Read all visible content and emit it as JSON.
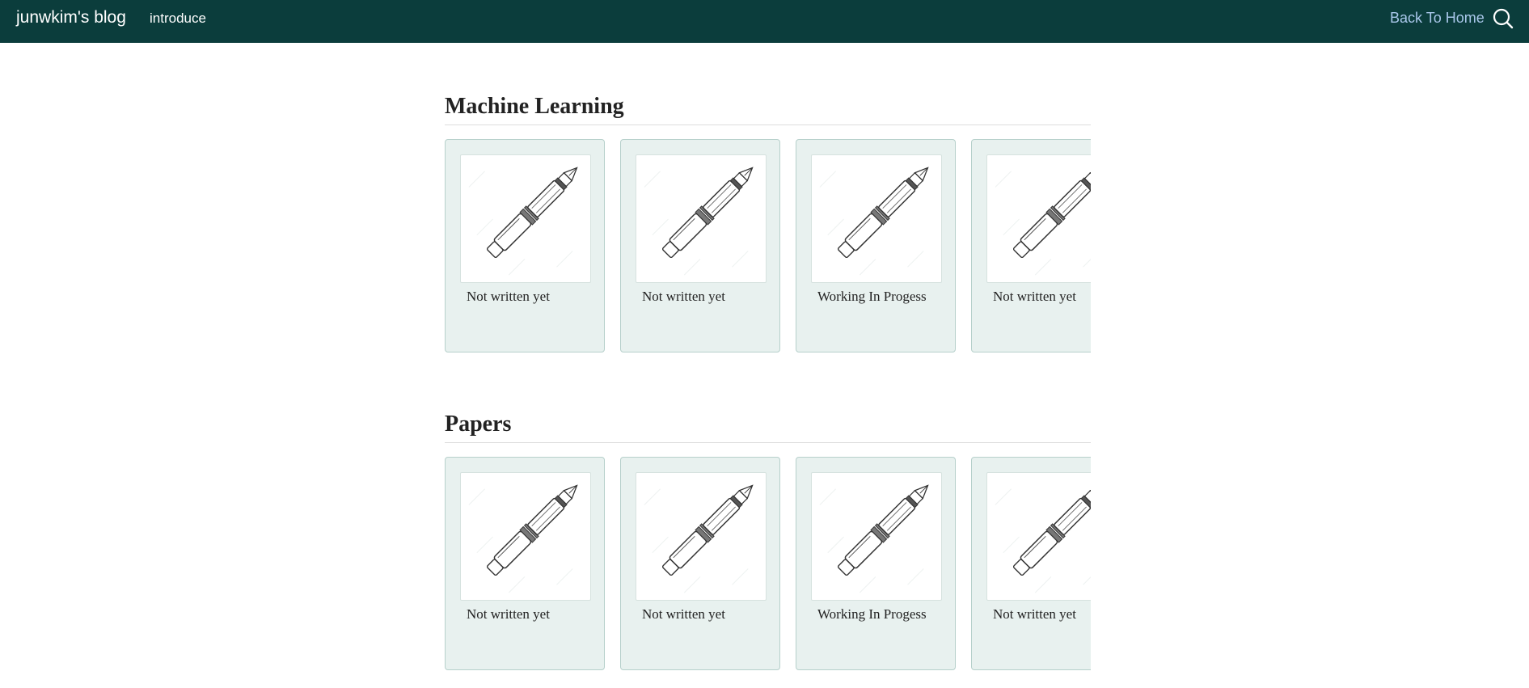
{
  "header": {
    "brand": "junwkim's blog",
    "nav_link": "introduce",
    "back_home": "Back To Home",
    "search_icon": "search-icon",
    "colors": {
      "bar": "#0b3d3c",
      "link": "#a9c7ea"
    }
  },
  "sections": [
    {
      "title": "Machine Learning",
      "cards": [
        {
          "caption": "Not written yet",
          "icon": "fountain-pen-icon"
        },
        {
          "caption": "Not written yet",
          "icon": "fountain-pen-icon"
        },
        {
          "caption": "Working In Progess",
          "icon": "fountain-pen-icon"
        },
        {
          "caption": "Not written yet",
          "icon": "fountain-pen-icon"
        }
      ]
    },
    {
      "title": "Papers",
      "cards": [
        {
          "caption": "Not written yet",
          "icon": "fountain-pen-icon"
        },
        {
          "caption": "Not written yet",
          "icon": "fountain-pen-icon"
        },
        {
          "caption": "Working In Progess",
          "icon": "fountain-pen-icon"
        },
        {
          "caption": "Not written yet",
          "icon": "fountain-pen-icon"
        }
      ]
    }
  ]
}
